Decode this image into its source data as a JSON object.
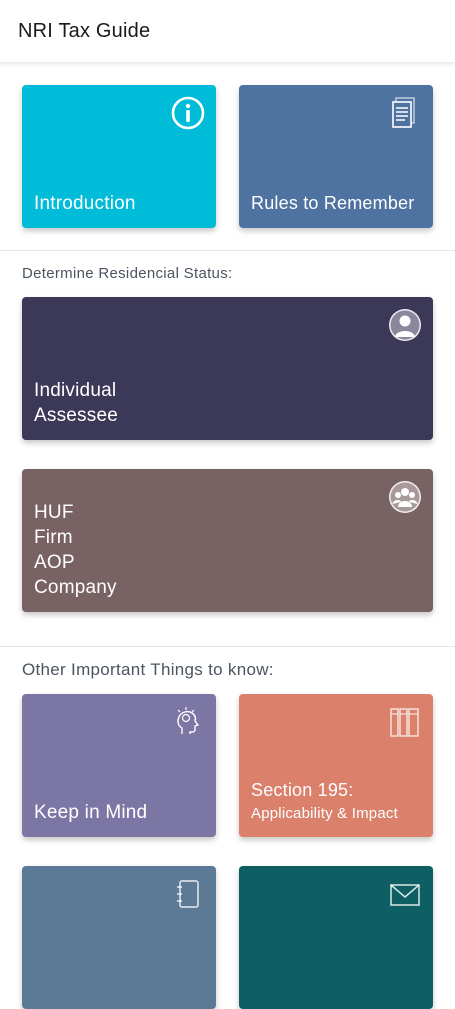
{
  "app": {
    "title": "NRI Tax Guide"
  },
  "cards": {
    "introduction": {
      "label": "Introduction",
      "color": "#00BCD8",
      "icon": "info-icon"
    },
    "rules": {
      "label": "Rules to Remember",
      "color": "#4F73A1",
      "icon": "document-icon"
    },
    "individual": {
      "line1": "Individual",
      "line2": "Assessee",
      "color": "#3C3858",
      "icon": "person-icon"
    },
    "huf": {
      "line1": "HUF",
      "line2": "Firm",
      "line3": "AOP",
      "line4": "Company",
      "color": "#786263",
      "icon": "group-icon"
    },
    "keep_in_mind": {
      "label": "Keep in Mind",
      "color": "#7C76A4",
      "icon": "head-idea-icon"
    },
    "section195": {
      "title": "Section 195:",
      "subtitle": "Applicability & Impact",
      "color": "#DA806B",
      "icon": "books-icon"
    },
    "contacts": {
      "color": "#5C7A96",
      "icon": "contacts-icon"
    },
    "mail": {
      "color": "#0E5F63",
      "icon": "mail-icon"
    }
  },
  "sections": {
    "residential": "Determine Residencial Status:",
    "other": "Other Important Things to know:"
  }
}
